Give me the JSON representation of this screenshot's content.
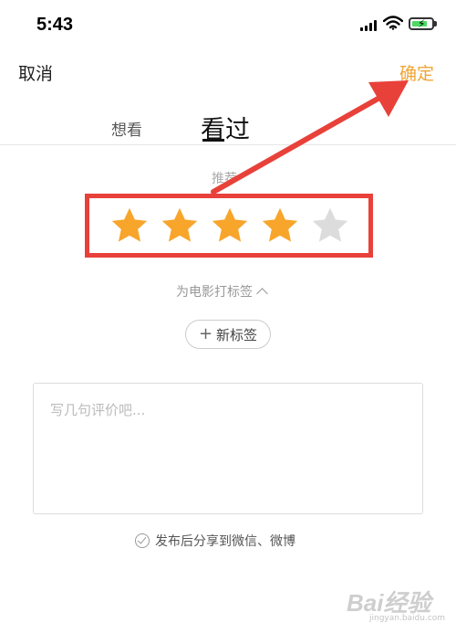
{
  "status_bar": {
    "time": "5:43"
  },
  "header": {
    "cancel_label": "取消",
    "confirm_label": "确定"
  },
  "tabs": {
    "want_label": "想看",
    "seen_label": "看过"
  },
  "rating": {
    "label": "推荐",
    "value": 4,
    "max": 5,
    "filled_color": "#f8a52c",
    "empty_color": "#dcdcdc"
  },
  "tags": {
    "toggle_label": "为电影打标签",
    "new_tag_label": "新标签"
  },
  "review": {
    "placeholder": "写几句评价吧..."
  },
  "share": {
    "label": "发布后分享到微信、微博"
  },
  "annotation": {
    "box_color": "#e8413a",
    "arrow_color": "#e8413a"
  },
  "watermark": {
    "brand": "Bai经验",
    "url": "jingyan.baidu.com"
  }
}
